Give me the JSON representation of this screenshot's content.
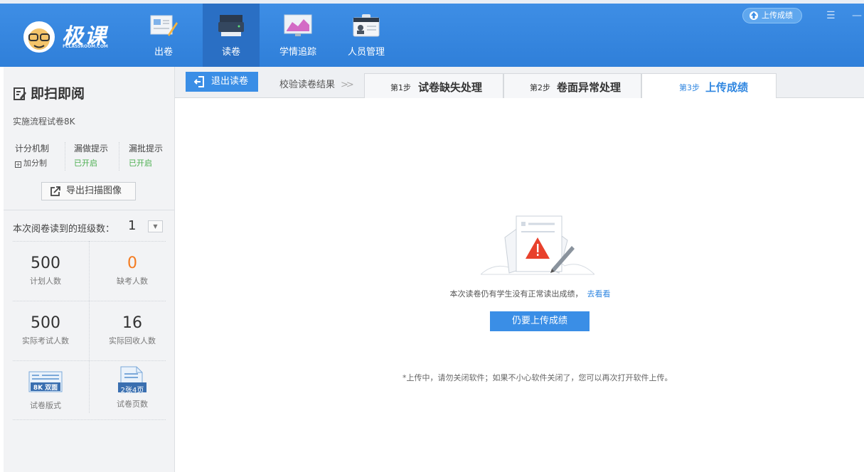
{
  "header": {
    "brand": "极课",
    "brand_sub": "FCLASSROOM.COM",
    "nav": [
      {
        "label": "出卷",
        "icon": "compose-paper-icon"
      },
      {
        "label": "读卷",
        "icon": "scanner-icon"
      },
      {
        "label": "学情追踪",
        "icon": "chart-monitor-icon"
      },
      {
        "label": "人员管理",
        "icon": "id-card-icon"
      }
    ],
    "active_nav": "读卷",
    "upload_button": "上传成绩"
  },
  "sidebar": {
    "title": "即扫即阅",
    "exam_name": "实施流程试卷8K",
    "settings": [
      {
        "label": "计分机制",
        "value": "加分制"
      },
      {
        "label": "漏做提示",
        "value": "已开启"
      },
      {
        "label": "漏批提示",
        "value": "已开启"
      }
    ],
    "export_button": "导出扫描图像",
    "class_count_label": "本次阅卷读到的班级数：",
    "class_count": "1",
    "stats": [
      {
        "value": "500",
        "label": "计划人数"
      },
      {
        "value": "0",
        "label": "缺考人数"
      },
      {
        "value": "500",
        "label": "实际考试人数"
      },
      {
        "value": "16",
        "label": "实际回收人数"
      }
    ],
    "paper_format": {
      "badge": "8K 双面",
      "label": "试卷版式"
    },
    "paper_pages": {
      "badge": "2张4页",
      "label": "试卷页数"
    }
  },
  "toolbar": {
    "exit_button": "退出读卷",
    "verify_label": "校验读卷结果",
    "tabs": [
      {
        "step": "第1步",
        "name": "试卷缺失处理"
      },
      {
        "step": "第2步",
        "name": "卷面异常处理"
      },
      {
        "step": "第3步",
        "name": "上传成绩"
      }
    ]
  },
  "content": {
    "notice": "本次读卷仍有学生没有正常读出成绩，",
    "notice_link": "去看看",
    "upload_anyway_button": "仍要上传成绩",
    "hint": "*上传中，请勿关闭软件；如果不小心软件关闭了，您可以再次打开软件上传。"
  },
  "colors": {
    "header_blue": "#3187e0",
    "accent_blue": "#3a8ee6",
    "enabled_green": "#4caf50",
    "warning_orange": "#f47b20",
    "alert_red": "#e8412c"
  }
}
